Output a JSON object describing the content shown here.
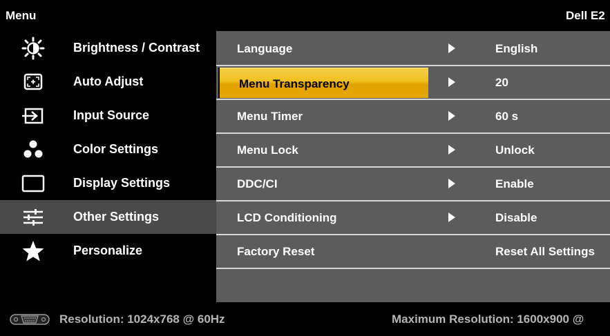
{
  "header": {
    "title": "Menu",
    "model": "Dell E2"
  },
  "left_menu": {
    "selected_index": 5,
    "items": [
      {
        "label": "Brightness / Contrast",
        "icon": "brightness-icon"
      },
      {
        "label": "Auto Adjust",
        "icon": "auto-adjust-icon"
      },
      {
        "label": "Input Source",
        "icon": "input-source-icon"
      },
      {
        "label": "Color Settings",
        "icon": "color-settings-icon"
      },
      {
        "label": "Display Settings",
        "icon": "display-settings-icon"
      },
      {
        "label": "Other Settings",
        "icon": "other-settings-icon"
      },
      {
        "label": "Personalize",
        "icon": "star-icon"
      }
    ]
  },
  "submenu": {
    "highlighted_index": 1,
    "rows": [
      {
        "label": "Language",
        "value": "English",
        "has_arrow": true
      },
      {
        "label": "Menu Transparency",
        "value": "20",
        "has_arrow": true
      },
      {
        "label": "Menu Timer",
        "value": "60 s",
        "has_arrow": true
      },
      {
        "label": "Menu Lock",
        "value": "Unlock",
        "has_arrow": true
      },
      {
        "label": "DDC/CI",
        "value": "Enable",
        "has_arrow": true
      },
      {
        "label": "LCD Conditioning",
        "value": "Disable",
        "has_arrow": true
      },
      {
        "label": "Factory Reset",
        "value": "Reset All Settings",
        "has_arrow": false
      }
    ]
  },
  "status": {
    "input_icon": "vga-connector-icon",
    "resolution": "Resolution: 1024x768 @ 60Hz",
    "max_resolution": "Maximum Resolution: 1600x900 @"
  },
  "colors": {
    "background": "#000000",
    "submenu_bg": "#5c5c5c",
    "selected_left_bg": "#4a4a4a",
    "highlight": "#f0b400",
    "separator": "#d8d8d8"
  }
}
